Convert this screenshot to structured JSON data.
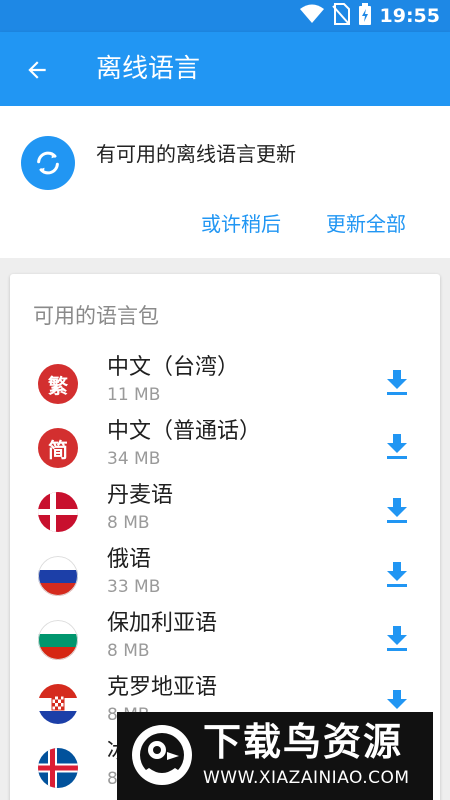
{
  "status_bar": {
    "time": "19:55"
  },
  "app_bar": {
    "title": "离线语言"
  },
  "update_card": {
    "message": "有可用的离线语言更新",
    "later_label": "或许稍后",
    "update_all_label": "更新全部"
  },
  "packs": {
    "section_title": "可用的语言包",
    "items": [
      {
        "name": "中文（台湾）",
        "size": "11 MB",
        "flag_text": "繁"
      },
      {
        "name": "中文（普通话）",
        "size": "34 MB",
        "flag_text": "简"
      },
      {
        "name": "丹麦语",
        "size": "8 MB",
        "flag": "denmark-flag"
      },
      {
        "name": "俄语",
        "size": "33 MB",
        "flag": "russia-flag"
      },
      {
        "name": "保加利亚语",
        "size": "8 MB",
        "flag": "bulgaria-flag"
      },
      {
        "name": "克罗地亚语",
        "size": "8 MB",
        "flag": "croatia-flag"
      },
      {
        "name": "冰",
        "size": "8",
        "flag": "iceland-flag"
      }
    ]
  },
  "watermark": {
    "title": "下载鸟资源",
    "url": "WWW.XIAZAINIAO.COM"
  },
  "colors": {
    "primary": "#2196f3",
    "status_bar": "#1e88e5",
    "chip_red": "#d32f2f"
  }
}
